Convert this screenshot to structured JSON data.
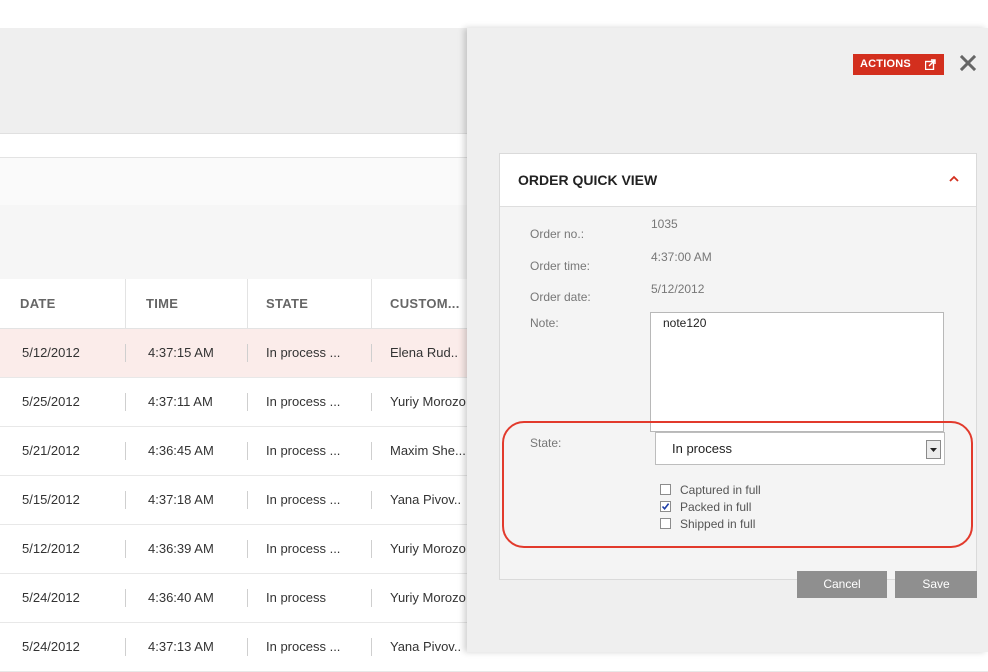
{
  "grid": {
    "columns": [
      "DATE",
      "TIME",
      "STATE",
      "CUSTOM..."
    ],
    "rows": [
      {
        "date": "5/12/2012",
        "time": "4:37:15 AM",
        "state": "In process ...",
        "customer": "Elena Rud..",
        "selected": true
      },
      {
        "date": "5/25/2012",
        "time": "4:37:11 AM",
        "state": "In process ...",
        "customer": "Yuriy Morozo",
        "selected": false
      },
      {
        "date": "5/21/2012",
        "time": "4:36:45 AM",
        "state": "In process ...",
        "customer": "Maxim She...",
        "selected": false
      },
      {
        "date": "5/15/2012",
        "time": "4:37:18 AM",
        "state": "In process ...",
        "customer": "Yana Pivov..",
        "selected": false
      },
      {
        "date": "5/12/2012",
        "time": "4:36:39 AM",
        "state": "In process ...",
        "customer": "Yuriy Morozo",
        "selected": false
      },
      {
        "date": "5/24/2012",
        "time": "4:36:40 AM",
        "state": "In process",
        "customer": "Yuriy Morozo",
        "selected": false
      },
      {
        "date": "5/24/2012",
        "time": "4:37:13 AM",
        "state": "In process ...",
        "customer": "Yana Pivov..",
        "selected": false
      }
    ]
  },
  "panel": {
    "actions_label": "ACTIONS",
    "actions_icon": "external-link-icon",
    "close_icon": "close-icon",
    "title": "ORDER QUICK VIEW",
    "collapse_icon": "chevron-up-icon",
    "fields": {
      "order_no_label": "Order no.:",
      "order_no": "1035",
      "order_time_label": "Order time:",
      "order_time": "4:37:00 AM",
      "order_date_label": "Order date:",
      "order_date": "5/12/2012",
      "note_label": "Note:",
      "note": "note120",
      "state_label": "State:",
      "state": "In process"
    },
    "checkboxes": [
      {
        "label": "Captured in full",
        "checked": false
      },
      {
        "label": "Packed in full",
        "checked": true
      },
      {
        "label": "Shipped in full",
        "checked": false
      }
    ],
    "cancel_label": "Cancel",
    "save_label": "Save"
  },
  "colors": {
    "accent": "#d32f1e",
    "highlight_outline": "#e23a2c",
    "selected_row": "#fbecea",
    "button_gray": "#8f8f8f"
  }
}
